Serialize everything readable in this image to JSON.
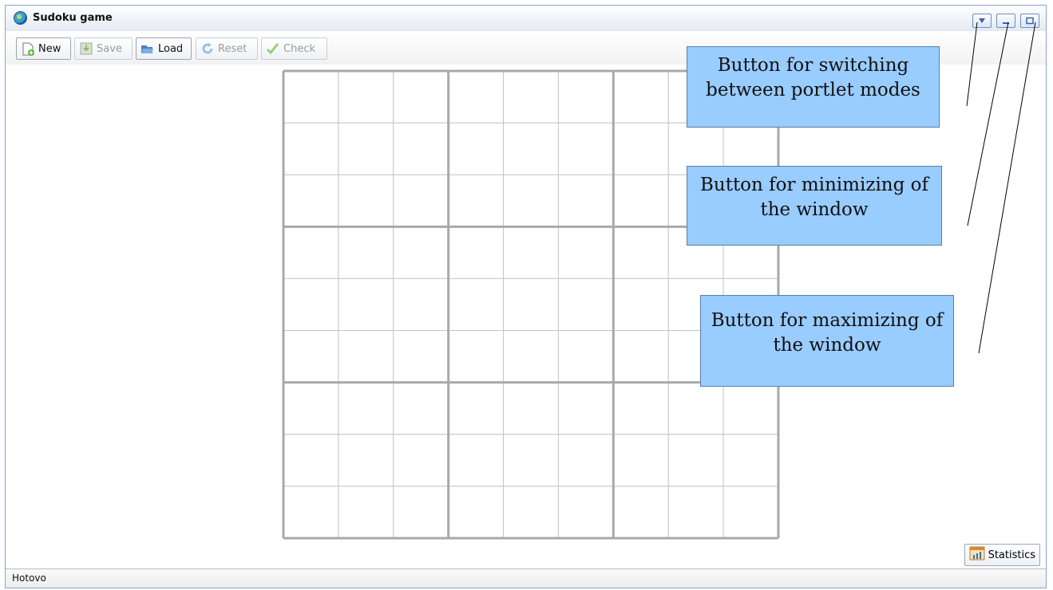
{
  "window": {
    "title": "Sudoku game"
  },
  "toolbar": {
    "new_label": "New",
    "save_label": "Save",
    "load_label": "Load",
    "reset_label": "Reset",
    "check_label": "Check"
  },
  "board": {
    "rows": 9,
    "cols": 9
  },
  "callouts": {
    "modes": "Button for switching between portlet modes",
    "minimize": "Button for minimizing of the window",
    "maximize": "Button for maximizing of the window"
  },
  "statistics_label": "Statistics",
  "status_text": "Hotovo"
}
